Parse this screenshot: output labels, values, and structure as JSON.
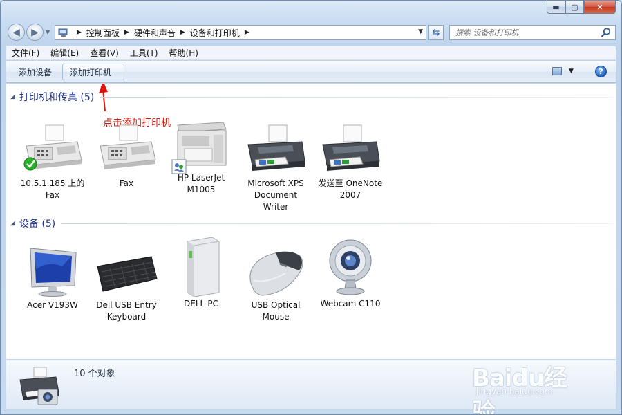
{
  "window": {
    "caption_min": "▬",
    "caption_max": "▢",
    "caption_close": "✕"
  },
  "address": {
    "crumbs": [
      "控制面板",
      "硬件和声音",
      "设备和打印机"
    ],
    "search_placeholder": "搜索 设备和打印机"
  },
  "menu": [
    "文件(F)",
    "编辑(E)",
    "查看(V)",
    "工具(T)",
    "帮助(H)"
  ],
  "toolbar": {
    "add_device": "添加设备",
    "add_printer": "添加打印机",
    "help": "?"
  },
  "groups": {
    "printers": {
      "title": "打印机和传真 (5)",
      "items": [
        {
          "label_lines": [
            "10.5.1.185 上的",
            "Fax"
          ],
          "icon": "fax-icon",
          "default": true
        },
        {
          "label_lines": [
            "Fax"
          ],
          "icon": "fax-icon"
        },
        {
          "label_lines": [
            "HP LaserJet",
            "M1005"
          ],
          "icon": "multifunction-printer-icon",
          "shared": true
        },
        {
          "label_lines": [
            "Microsoft XPS",
            "Document",
            "Writer"
          ],
          "icon": "printer-icon"
        },
        {
          "label_lines": [
            "发送至 OneNote",
            "2007"
          ],
          "icon": "printer-icon"
        }
      ]
    },
    "devices": {
      "title": "设备 (5)",
      "items": [
        {
          "label_lines": [
            "Acer V193W"
          ],
          "icon": "monitor-icon"
        },
        {
          "label_lines": [
            "Dell USB Entry",
            "Keyboard"
          ],
          "icon": "keyboard-icon"
        },
        {
          "label_lines": [
            "DELL-PC"
          ],
          "icon": "computer-tower-icon"
        },
        {
          "label_lines": [
            "USB Optical",
            "Mouse"
          ],
          "icon": "mouse-icon"
        },
        {
          "label_lines": [
            "Webcam C110"
          ],
          "icon": "webcam-icon"
        }
      ]
    }
  },
  "annotation": "点击添加打印机",
  "details": {
    "count": "10 个对象"
  },
  "watermark": {
    "brand": "Baidu经验",
    "url": "jingyan.baidu.com"
  },
  "colors": {
    "group_title": "#1e3287",
    "annotation": "#d61e10"
  }
}
